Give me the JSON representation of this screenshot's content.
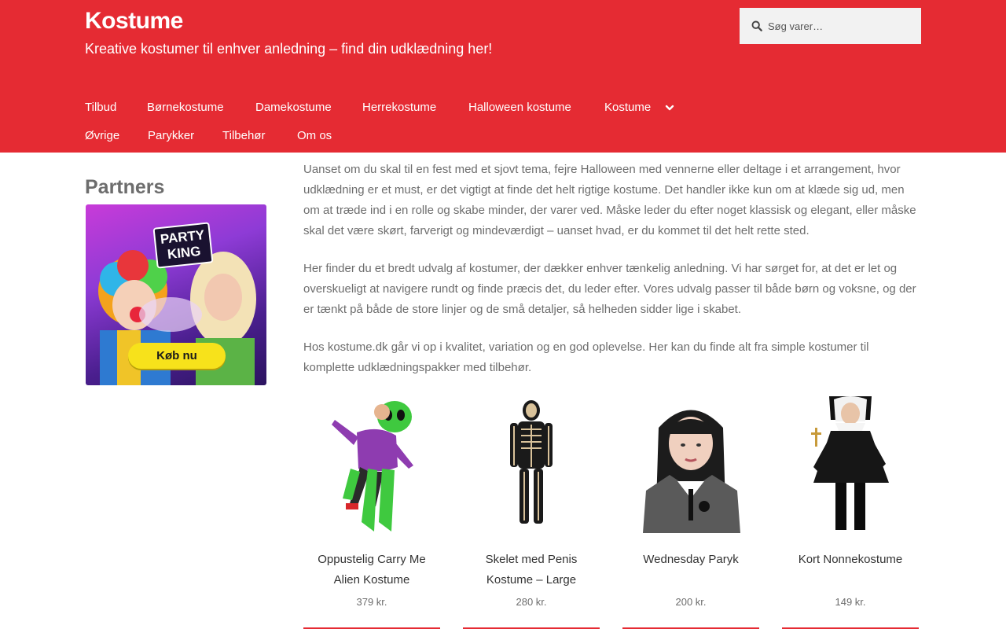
{
  "site": {
    "title": "Kostume",
    "tagline": "Kreative kostumer til enhver anledning – find din udklædning her!"
  },
  "search": {
    "placeholder": "Søg varer…"
  },
  "nav": {
    "row1": [
      "Tilbud",
      "Børnekostume",
      "Damekostume",
      "Herrekostume",
      "Halloween kostume",
      "Kostume"
    ],
    "row2": [
      "Øvrige",
      "Parykker",
      "Tilbehør",
      "Om os"
    ]
  },
  "sidebar": {
    "title": "Partners",
    "ad": {
      "logo_line1": "PARTY",
      "logo_line2": "KING",
      "button": "Køb nu"
    }
  },
  "content": {
    "paragraphs": [
      "Uanset om du skal til en fest med et sjovt tema, fejre Halloween med vennerne eller deltage i et arrangement, hvor udklædning er et must, er det vigtigt at finde det helt rigtige kostume. Det handler ikke kun om at klæde sig ud, men om at træde ind i en rolle og skabe minder, der varer ved. Måske leder du efter noget klassisk og elegant, eller måske skal det være skørt, farverigt og mindeværdigt – uanset hvad, er du kommet til det helt rette sted.",
      "Her finder du et bredt udvalg af kostumer, der dækker enhver tænkelig anledning. Vi har sørget for, at det er let og overskueligt at navigere rundt og finde præcis det, du leder efter. Vores udvalg passer til både børn og voksne, og der er tænkt på både de store linjer og de små detaljer, så helheden sidder lige i skabet.",
      "Hos kostume.dk går vi op i kvalitet, variation og en god oplevelse. Her kan du finde alt fra simple kostumer til komplette udklædningspakker med tilbehør."
    ]
  },
  "products": [
    {
      "title": "Oppustelig Carry Me Alien Kostume",
      "price": "379 kr."
    },
    {
      "title": "Skelet med Penis Kostume – Large",
      "price": "280 kr."
    },
    {
      "title": "Wednesday Paryk",
      "price": "200 kr."
    },
    {
      "title": "Kort Nonnekostume",
      "price": "149 kr."
    }
  ],
  "colors": {
    "brand": "#e52b33",
    "text": "#6d6d6d",
    "search_bg": "#f2f2f2"
  }
}
